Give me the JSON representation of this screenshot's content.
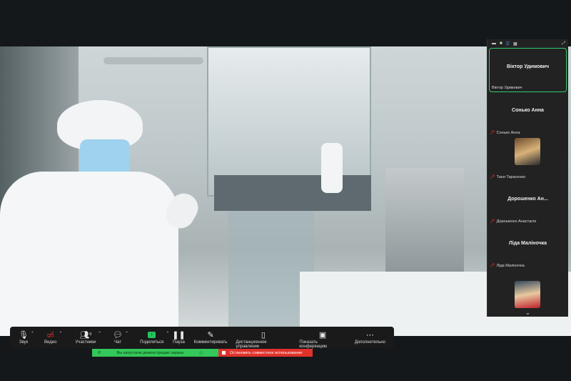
{
  "toolbar": {
    "items": [
      {
        "label": "Звук",
        "icon": "microphone-icon"
      },
      {
        "label": "Видео",
        "icon": "video-off-icon"
      },
      {
        "label": "Участники",
        "icon": "participants-icon",
        "count": "9"
      },
      {
        "label": "Чат",
        "icon": "chat-icon"
      },
      {
        "label": "Поделиться",
        "icon": "share-screen-icon"
      },
      {
        "label": "Пауза",
        "icon": "pause-icon"
      },
      {
        "label": "Комментировать",
        "icon": "annotate-icon"
      },
      {
        "label": "Дистанционное управление",
        "icon": "mouse-icon"
      },
      {
        "label": "Показать конференцию",
        "icon": "show-meeting-icon"
      },
      {
        "label": "Дополнительно",
        "icon": "more-icon"
      }
    ]
  },
  "banner": {
    "sharing_text": "Вы запустили демонстрацию экрана",
    "stop_label": "Остановить совместное использование"
  },
  "panel": {
    "tiles": [
      {
        "title": "Віктор Удимович",
        "name": "Віктор Удимович",
        "active": true
      },
      {
        "title": "Сонько Анна",
        "name": "Сонько Анна"
      },
      {
        "name": "Таня Тарасенко"
      },
      {
        "title": "Дорошенко  Ан...",
        "name": "Дорошенко Анастасія"
      },
      {
        "title": "Ліда Маліночка",
        "name": "Ліда Маліночка"
      }
    ]
  },
  "colors": {
    "share_green": "#34c759",
    "stop_red": "#e0322c",
    "active_border": "#2ecc71"
  }
}
